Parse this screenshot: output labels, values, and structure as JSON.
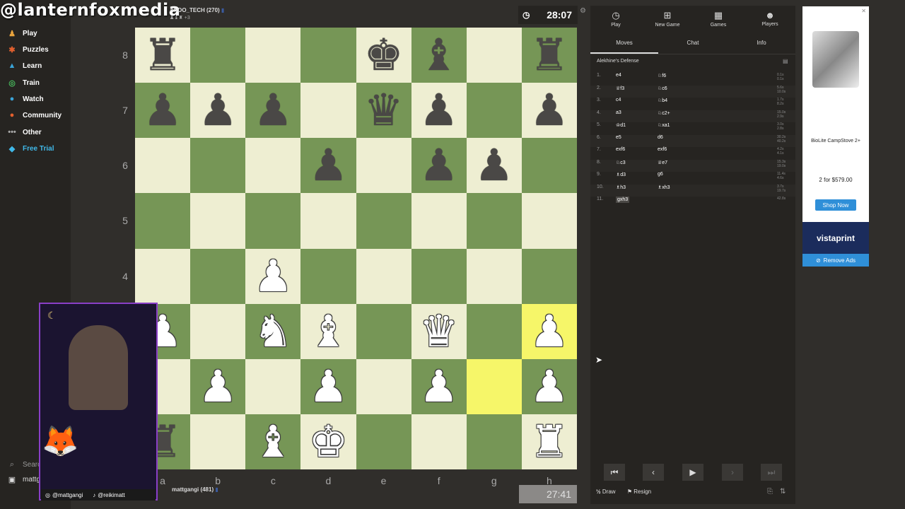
{
  "overlay": {
    "brand": "@lanternfoxmedia"
  },
  "leftnav": {
    "items": [
      {
        "label": "Play",
        "icon": "play-icon",
        "color": "#e8a33d"
      },
      {
        "label": "Puzzles",
        "icon": "puzzle-icon",
        "color": "#e3602e"
      },
      {
        "label": "Learn",
        "icon": "learn-icon",
        "color": "#3aa4d8"
      },
      {
        "label": "Train",
        "icon": "train-icon",
        "color": "#48b85c"
      },
      {
        "label": "Watch",
        "icon": "watch-icon",
        "color": "#3aa4d8"
      },
      {
        "label": "Community",
        "icon": "community-icon",
        "color": "#e3602e"
      },
      {
        "label": "Other",
        "icon": "more-icon",
        "color": "#aaaaaa"
      },
      {
        "label": "Free Trial",
        "icon": "diamond-icon",
        "color": "#40b8e8"
      }
    ],
    "search": "Search",
    "user": "mattg"
  },
  "top_player": {
    "name": "ANDO_TECH (270)",
    "captured": "+3"
  },
  "top_clock": "28:07",
  "bottom_player": {
    "name": "mattgangi (481)"
  },
  "bottom_clock": "27:41",
  "board": {
    "ranks": [
      "8",
      "7",
      "6",
      "5",
      "4",
      "3",
      "2",
      "1"
    ],
    "files": [
      "a",
      "b",
      "c",
      "d",
      "e",
      "f",
      "g",
      "h"
    ],
    "pieces": [
      [
        "br",
        "",
        "",
        "",
        "bk",
        "bb",
        "",
        "br"
      ],
      [
        "bp",
        "bp",
        "bp",
        "",
        "bq",
        "bp",
        "",
        "bp"
      ],
      [
        "",
        "",
        "",
        "bp",
        "",
        "bp",
        "bp",
        ""
      ],
      [
        "",
        "",
        "",
        "",
        "",
        "",
        "",
        ""
      ],
      [
        "",
        "",
        "wp",
        "",
        "",
        "",
        "",
        ""
      ],
      [
        "wp",
        "",
        "wn",
        "wb",
        "",
        "wq",
        "",
        "wp"
      ],
      [
        "",
        "wp",
        "",
        "wp",
        "",
        "wp",
        "",
        "wp"
      ],
      [
        "br",
        "",
        "wb",
        "wk",
        "",
        "",
        "",
        "wr"
      ]
    ],
    "highlight": [
      [
        5,
        7
      ],
      [
        6,
        6
      ]
    ]
  },
  "panel": {
    "topnav": [
      {
        "label": "Play",
        "icon": "timer-icon"
      },
      {
        "label": "New Game",
        "icon": "plus-icon"
      },
      {
        "label": "Games",
        "icon": "games-icon"
      },
      {
        "label": "Players",
        "icon": "players-icon"
      }
    ],
    "tabs": [
      "Moves",
      "Chat",
      "Info"
    ],
    "opening": "Alekhine's Defense",
    "moves": [
      {
        "n": "1.",
        "w": "e4",
        "b": "♘f6",
        "t1": "0.1s",
        "t2": "0.1s"
      },
      {
        "n": "2.",
        "w": "♕f3",
        "b": "♘c6",
        "t1": "5.6s",
        "t2": "10.0s"
      },
      {
        "n": "3.",
        "w": "c4",
        "b": "♘b4",
        "t1": "1.7s",
        "t2": "8.2s"
      },
      {
        "n": "4.",
        "w": "a3",
        "b": "♘c2+",
        "t1": "15.0s",
        "t2": "2.9s"
      },
      {
        "n": "5.",
        "w": "♔d1",
        "b": "♘xa1",
        "t1": "3.0s",
        "t2": "2.8s"
      },
      {
        "n": "6.",
        "w": "e5",
        "b": "d6",
        "t1": "30.2s",
        "t2": "40.2s"
      },
      {
        "n": "7.",
        "w": "exf6",
        "b": "exf6",
        "t1": "4.2s",
        "t2": "4.1s"
      },
      {
        "n": "8.",
        "w": "♘c3",
        "b": "♕e7",
        "t1": "15.3s",
        "t2": "19.0s"
      },
      {
        "n": "9.",
        "w": "♗d3",
        "b": "g6",
        "t1": "11.4s",
        "t2": "4.6s"
      },
      {
        "n": "10.",
        "w": "♗h3",
        "b": "♗xh3",
        "t1": "3.7s",
        "t2": "19.7s"
      },
      {
        "n": "11.",
        "w": "gxh3",
        "b": "",
        "t1": "42.8s",
        "t2": ""
      }
    ],
    "draw": "Draw",
    "resign": "Resign"
  },
  "ad": {
    "product": "BioLite CampStove 2+",
    "price": "2 for $579.00",
    "cta": "Shop Now",
    "sponsor": "vistaprint",
    "remove": "Remove Ads"
  },
  "cam": {
    "handle1": "@mattgangi",
    "handle2": "@reikimatt"
  }
}
